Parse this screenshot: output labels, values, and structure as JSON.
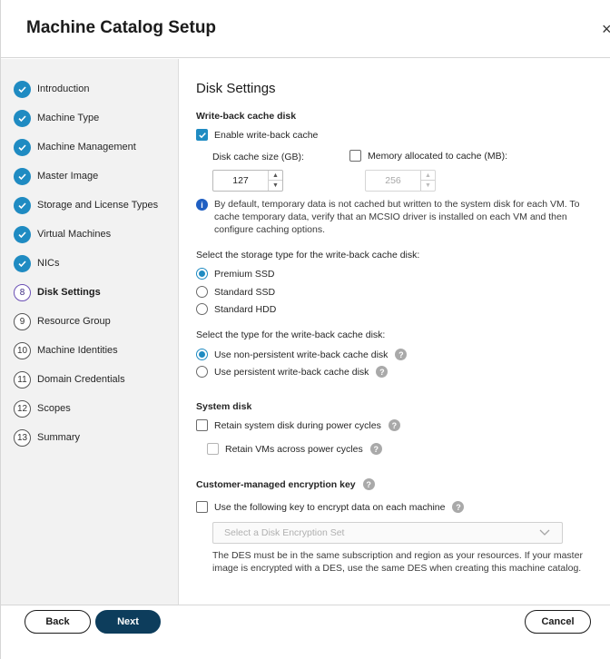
{
  "dialog": {
    "title": "Machine Catalog Setup",
    "close_glyph": "×"
  },
  "sidebar": {
    "steps": [
      {
        "label": "Introduction",
        "state": "done"
      },
      {
        "label": "Machine Type",
        "state": "done"
      },
      {
        "label": "Machine Management",
        "state": "done"
      },
      {
        "label": "Master Image",
        "state": "done"
      },
      {
        "label": "Storage and License Types",
        "state": "done"
      },
      {
        "label": "Virtual Machines",
        "state": "done"
      },
      {
        "label": "NICs",
        "state": "done"
      },
      {
        "label": "Disk Settings",
        "state": "current",
        "number": "8"
      },
      {
        "label": "Resource Group",
        "state": "pending",
        "number": "9"
      },
      {
        "label": "Machine Identities",
        "state": "pending",
        "number": "10"
      },
      {
        "label": "Domain Credentials",
        "state": "pending",
        "number": "11"
      },
      {
        "label": "Scopes",
        "state": "pending",
        "number": "12"
      },
      {
        "label": "Summary",
        "state": "pending",
        "number": "13"
      }
    ]
  },
  "main": {
    "heading": "Disk Settings",
    "writeback": {
      "heading": "Write-back cache disk",
      "enable_label": "Enable write-back cache",
      "enable_checked": true,
      "disk_size_label": "Disk cache size (GB):",
      "disk_size_value": "127",
      "memory_label": "Memory allocated to cache (MB):",
      "memory_checked": false,
      "memory_value": "256",
      "info_text": "By default, temporary data is not cached but written to the system disk for each VM. To cache temporary data, verify that an MCSIO driver is installed on each VM and then configure caching options."
    },
    "storage_type": {
      "label": "Select the storage type for the write-back cache disk:",
      "options": [
        "Premium SSD",
        "Standard SSD",
        "Standard HDD"
      ],
      "selected": "Premium SSD"
    },
    "cache_type": {
      "label": "Select the type for the write-back cache disk:",
      "options": [
        "Use non-persistent write-back cache disk",
        "Use persistent write-back cache disk"
      ],
      "selected": "Use non-persistent write-back cache disk"
    },
    "system_disk": {
      "heading": "System disk",
      "retain_disk_label": "Retain system disk during power cycles",
      "retain_vms_label": "Retain VMs across power cycles"
    },
    "encryption": {
      "heading": "Customer-managed encryption key",
      "use_key_label": "Use the following key to encrypt data on each machine",
      "select_placeholder": "Select a Disk Encryption Set",
      "note": "The DES must be in the same subscription and region as your resources. If your master image is encrypted with a DES, use the same DES when creating this machine catalog."
    },
    "help_glyph": "?"
  },
  "footer": {
    "back_label": "Back",
    "next_label": "Next",
    "cancel_label": "Cancel"
  },
  "colors": {
    "accent": "#1f8bc2",
    "primary_button": "#0d3d5c",
    "current_step": "#6a4fb5",
    "sidebar_bg": "#f2f2f2"
  }
}
